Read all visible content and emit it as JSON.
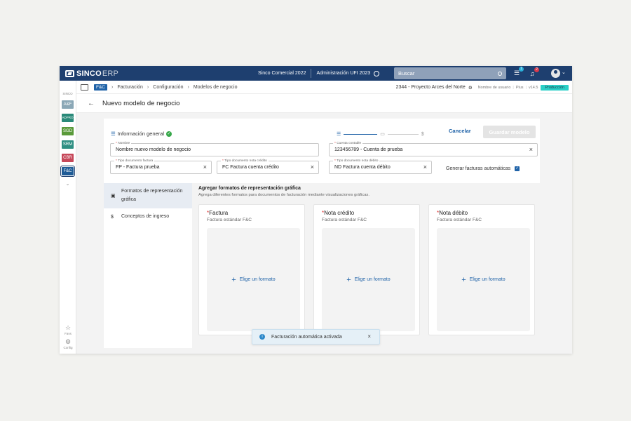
{
  "topbar": {
    "logo": "SINCO",
    "logo_suffix": "ERP",
    "company": "Sinco Comercial 2022",
    "admin": "Administración UFI 2023",
    "search_placeholder": "Buscar",
    "tasks_badge": "1",
    "notif_badge": "2"
  },
  "sidebar": {
    "title": "SINCO",
    "modules": [
      {
        "label": "A&F",
        "color": "#8aa7b6"
      },
      {
        "label": "ADPRO",
        "color": "#2a8a7a"
      },
      {
        "label": "SGD",
        "color": "#5a9a3a"
      },
      {
        "label": "SRM",
        "color": "#2f8f83"
      },
      {
        "label": "CBR",
        "color": "#c6485a"
      },
      {
        "label": "F&C",
        "color": "#1e5b96"
      }
    ],
    "favs": "Favs",
    "config": "Config"
  },
  "breadcrumb": {
    "tag": "F&C",
    "items": [
      "Facturación",
      "Configuración",
      "Modelos de negocio"
    ],
    "project": "2344 - Proyecto Arces del Norte",
    "user": "Nombre de usuario",
    "plan": "Plus",
    "version": "v14.5",
    "env": "Producción"
  },
  "header": {
    "title": "Nuevo modelo de negocio"
  },
  "form": {
    "section_title": "Información general",
    "cancel": "Cancelar",
    "save": "Guardar modelo",
    "nombre_label": "Nombre",
    "nombre_value": "Nombre nuevo modelo de negocio",
    "cuenta_label": "Cuenta contable",
    "cuenta_value": "123456789 - Cuenta de prueba",
    "tipo_factura_label": "Tipo documento factura",
    "tipo_factura_value": "FP - Factura prueba",
    "tipo_credito_label": "Tipo documento nota crédito",
    "tipo_credito_value": "FC Factura cuenta crédito",
    "tipo_debito_label": "Tipo documento nota débito",
    "tipo_debito_value": "ND Factura cuenta débito",
    "auto_label": "Generar facturas automáticas"
  },
  "nav": {
    "item1": "Formatos de representación gráfica",
    "item2": "Conceptos de ingreso"
  },
  "formats": {
    "title": "Agregar formatos de representación gráfica",
    "subtitle": "Agrega diferentes formatos para documentos de facturación mediante visualizaciones gráficas.",
    "cards": [
      {
        "title": "Factura",
        "subtitle": "Factura estándar F&C",
        "action": "Elige un formato"
      },
      {
        "title": "Nota crédito",
        "subtitle": "Factura estándar F&C",
        "action": "Elige un formato"
      },
      {
        "title": "Nota débito",
        "subtitle": "Factura estándar F&C",
        "action": "Elige un formato"
      }
    ]
  },
  "toast": {
    "message": "Facturación automática activada"
  }
}
